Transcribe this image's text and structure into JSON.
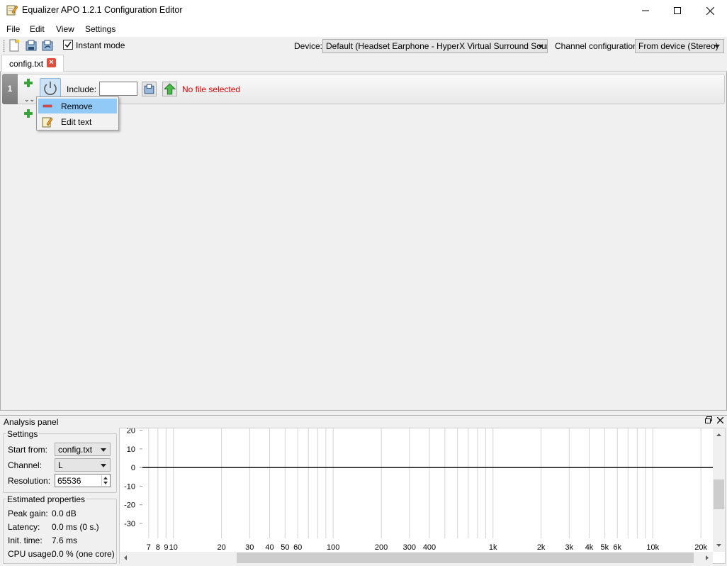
{
  "window": {
    "title": "Equalizer APO 1.2.1 Configuration Editor",
    "icon": "notepad-pencil-icon"
  },
  "menu": [
    "File",
    "Edit",
    "View",
    "Settings"
  ],
  "toolbar": {
    "instant_mode_label": "Instant mode",
    "instant_mode_checked": true,
    "device_label": "Device:",
    "device_value": "Default (Headset Earphone - HyperX Virtual Surround Sound)",
    "channel_config_label": "Channel configuration:",
    "channel_config_value": "From device (Stereo)"
  },
  "tab": {
    "label": "config.txt"
  },
  "filter_row": {
    "number": "1",
    "include_label": "Include:",
    "include_value": "",
    "status": "No file selected"
  },
  "context_menu": {
    "items": [
      {
        "label": "Remove",
        "icon": "minus-icon",
        "selected": true
      },
      {
        "label": "Edit text",
        "icon": "edit-text-icon",
        "selected": false
      }
    ]
  },
  "analysis": {
    "title": "Analysis panel",
    "settings_title": "Settings",
    "start_from_label": "Start from:",
    "start_from_value": "config.txt",
    "channel_label": "Channel:",
    "channel_value": "L",
    "resolution_label": "Resolution:",
    "resolution_value": "65536",
    "estimated_title": "Estimated properties",
    "peak_gain_label": "Peak gain:",
    "peak_gain_value": "0.0 dB",
    "latency_label": "Latency:",
    "latency_value": "0.0 ms (0 s.)",
    "init_time_label": "Init. time:",
    "init_time_value": "7.6 ms",
    "cpu_label": "CPU usage:",
    "cpu_value": "0.0 % (one core)"
  },
  "chart_data": {
    "type": "line",
    "x_scale": "log",
    "xlim": [
      6.4,
      24000
    ],
    "ylim": [
      -38,
      21
    ],
    "x_ticks": [
      {
        "v": 7,
        "label": "7"
      },
      {
        "v": 8,
        "label": "8"
      },
      {
        "v": 9,
        "label": "9"
      },
      {
        "v": 10,
        "label": "10"
      },
      {
        "v": 20,
        "label": "20"
      },
      {
        "v": 30,
        "label": "30"
      },
      {
        "v": 40,
        "label": "40"
      },
      {
        "v": 50,
        "label": "50"
      },
      {
        "v": 60,
        "label": "60"
      },
      {
        "v": 70,
        "label": ""
      },
      {
        "v": 80,
        "label": ""
      },
      {
        "v": 90,
        "label": ""
      },
      {
        "v": 100,
        "label": "100"
      },
      {
        "v": 200,
        "label": "200"
      },
      {
        "v": 300,
        "label": "300"
      },
      {
        "v": 400,
        "label": "400"
      },
      {
        "v": 500,
        "label": ""
      },
      {
        "v": 600,
        "label": ""
      },
      {
        "v": 700,
        "label": ""
      },
      {
        "v": 800,
        "label": ""
      },
      {
        "v": 900,
        "label": ""
      },
      {
        "v": 1000,
        "label": "1k"
      },
      {
        "v": 2000,
        "label": "2k"
      },
      {
        "v": 3000,
        "label": "3k"
      },
      {
        "v": 4000,
        "label": "4k"
      },
      {
        "v": 5000,
        "label": "5k"
      },
      {
        "v": 6000,
        "label": "6k"
      },
      {
        "v": 7000,
        "label": ""
      },
      {
        "v": 8000,
        "label": ""
      },
      {
        "v": 9000,
        "label": ""
      },
      {
        "v": 10000,
        "label": "10k"
      },
      {
        "v": 20000,
        "label": "20k"
      }
    ],
    "y_ticks": [
      20,
      10,
      0,
      -10,
      -20,
      -30
    ],
    "series": [
      {
        "x": [
          6.4,
          24000
        ],
        "y": [
          0,
          0
        ],
        "color": "#000000"
      }
    ],
    "grid": true
  }
}
